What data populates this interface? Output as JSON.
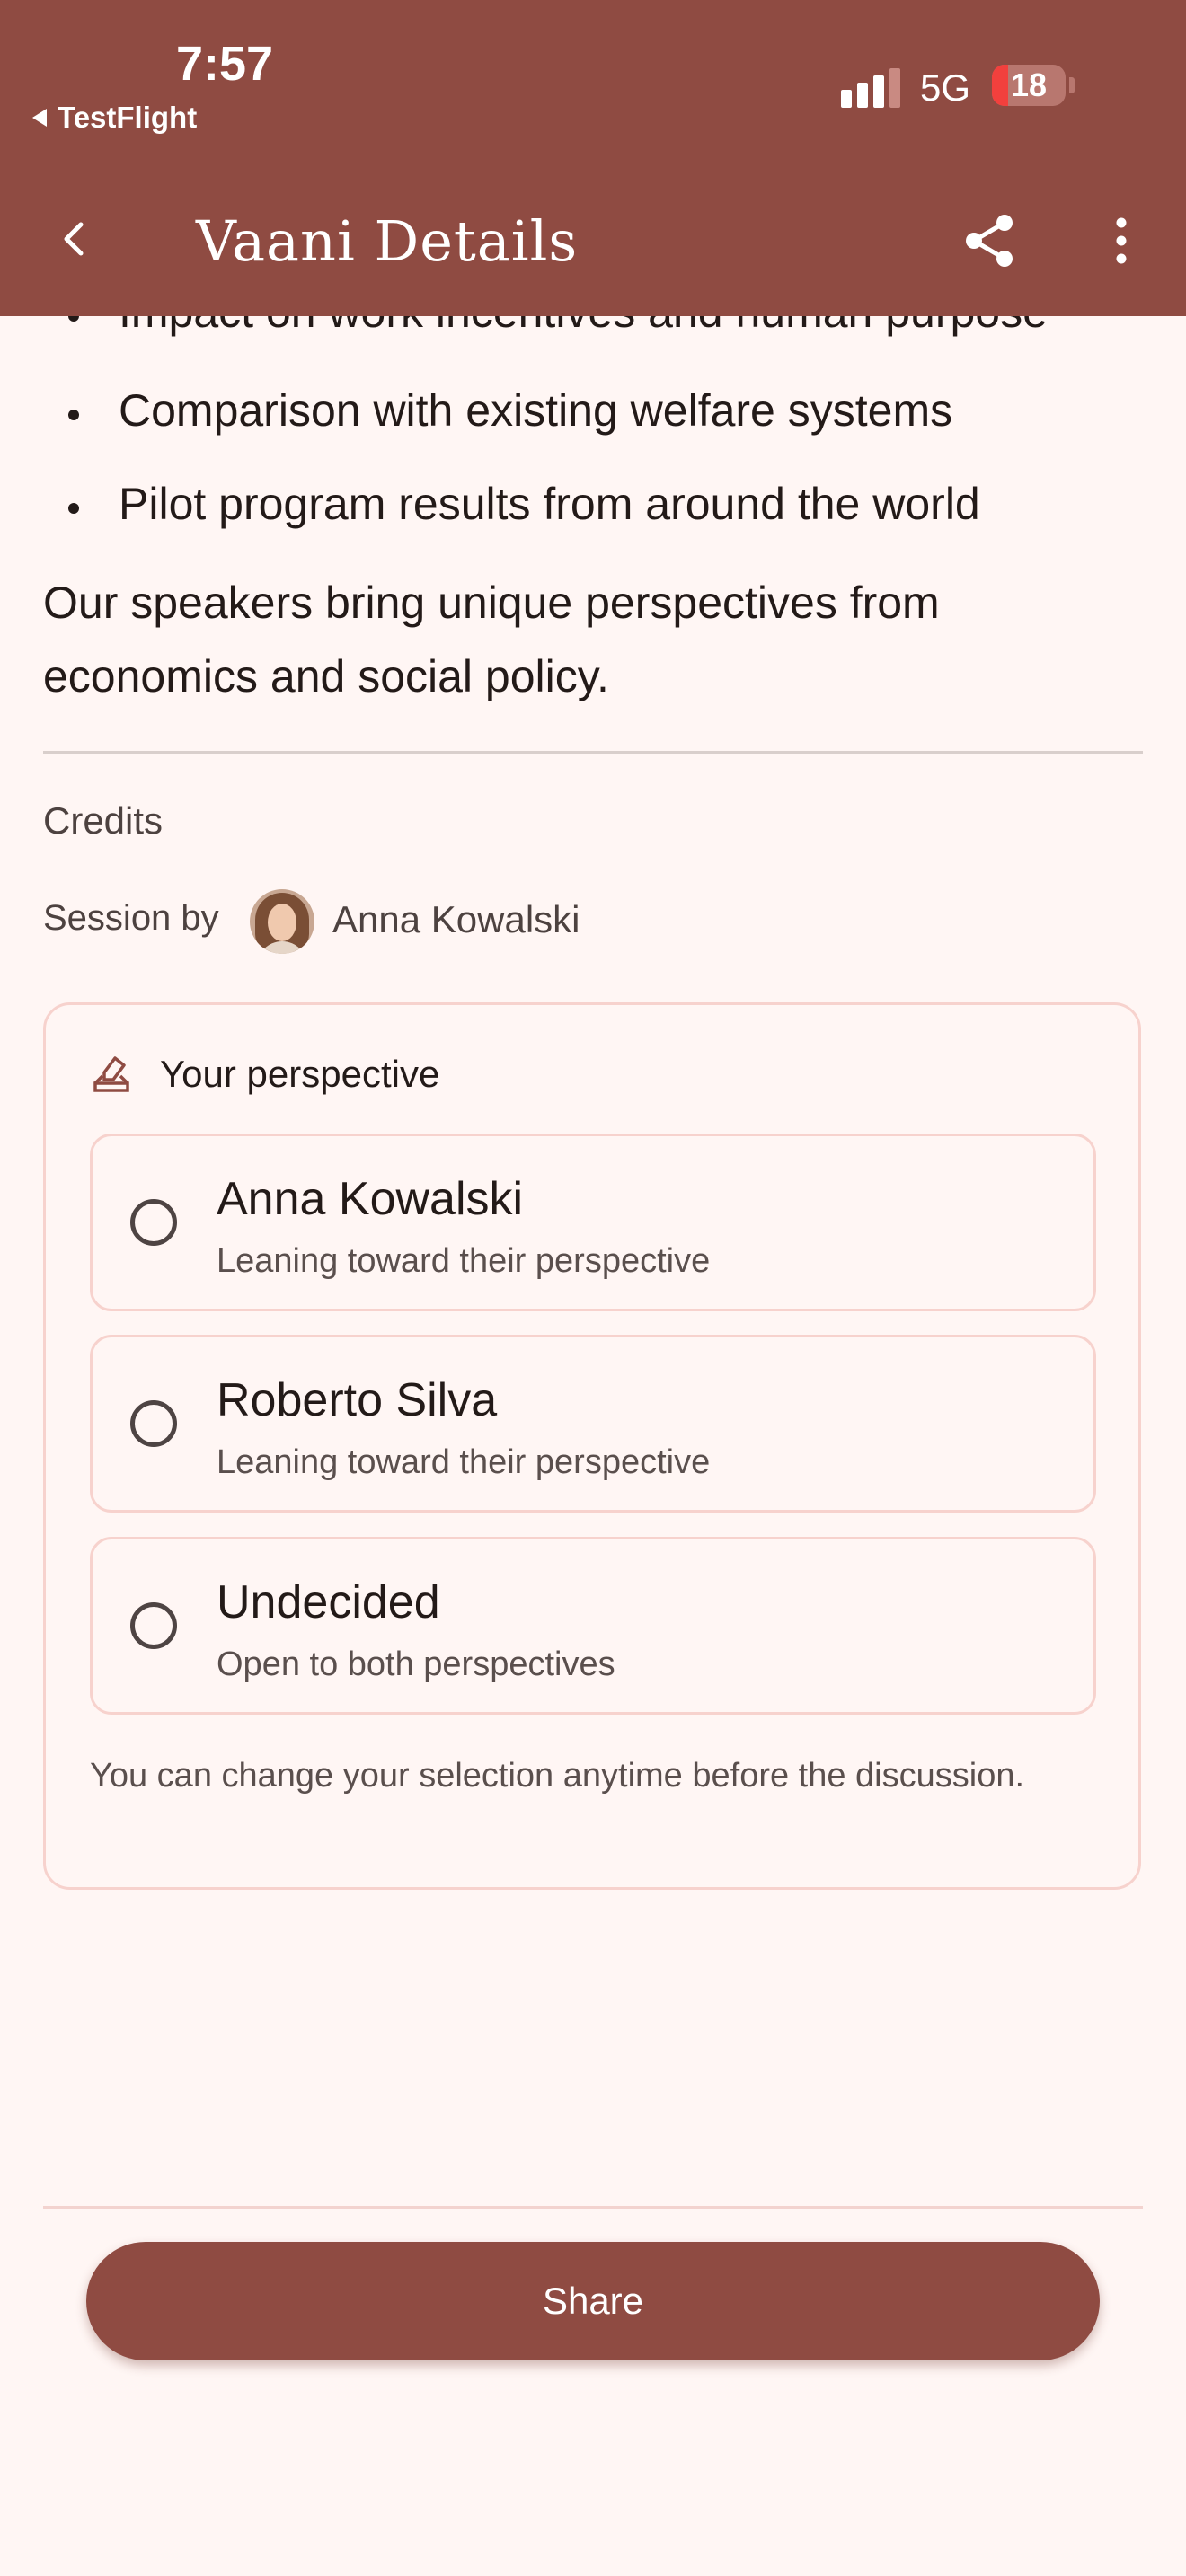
{
  "status_bar": {
    "time": "7:57",
    "back_app": "TestFlight",
    "network": "5G",
    "battery": "18"
  },
  "app_bar": {
    "title": "Vaani Details",
    "back_icon": "chevron-left-icon",
    "share_icon": "share-icon",
    "more_icon": "more-vertical-icon"
  },
  "description": {
    "bullets": [
      "Impact on work incentives and human purpose",
      "Comparison with existing welfare systems",
      "Pilot program results from around the world"
    ],
    "paragraph": "Our speakers bring unique perspectives from economics and social policy."
  },
  "credits": {
    "heading": "Credits",
    "session_by_label": "Session by",
    "speaker_name": "Anna Kowalski"
  },
  "perspective": {
    "title": "Your perspective",
    "icon": "vote-icon",
    "options": [
      {
        "name": "Anna Kowalski",
        "subtitle": "Leaning toward their perspective"
      },
      {
        "name": "Roberto Silva",
        "subtitle": "Leaning toward their perspective"
      },
      {
        "name": "Undecided",
        "subtitle": "Open to both perspectives"
      }
    ],
    "note": "You can change your selection anytime before the discussion."
  },
  "footer": {
    "share_label": "Share"
  },
  "colors": {
    "primary": "#8f4b42",
    "background": "#fff6f4",
    "card_border": "#f7d2cd"
  }
}
